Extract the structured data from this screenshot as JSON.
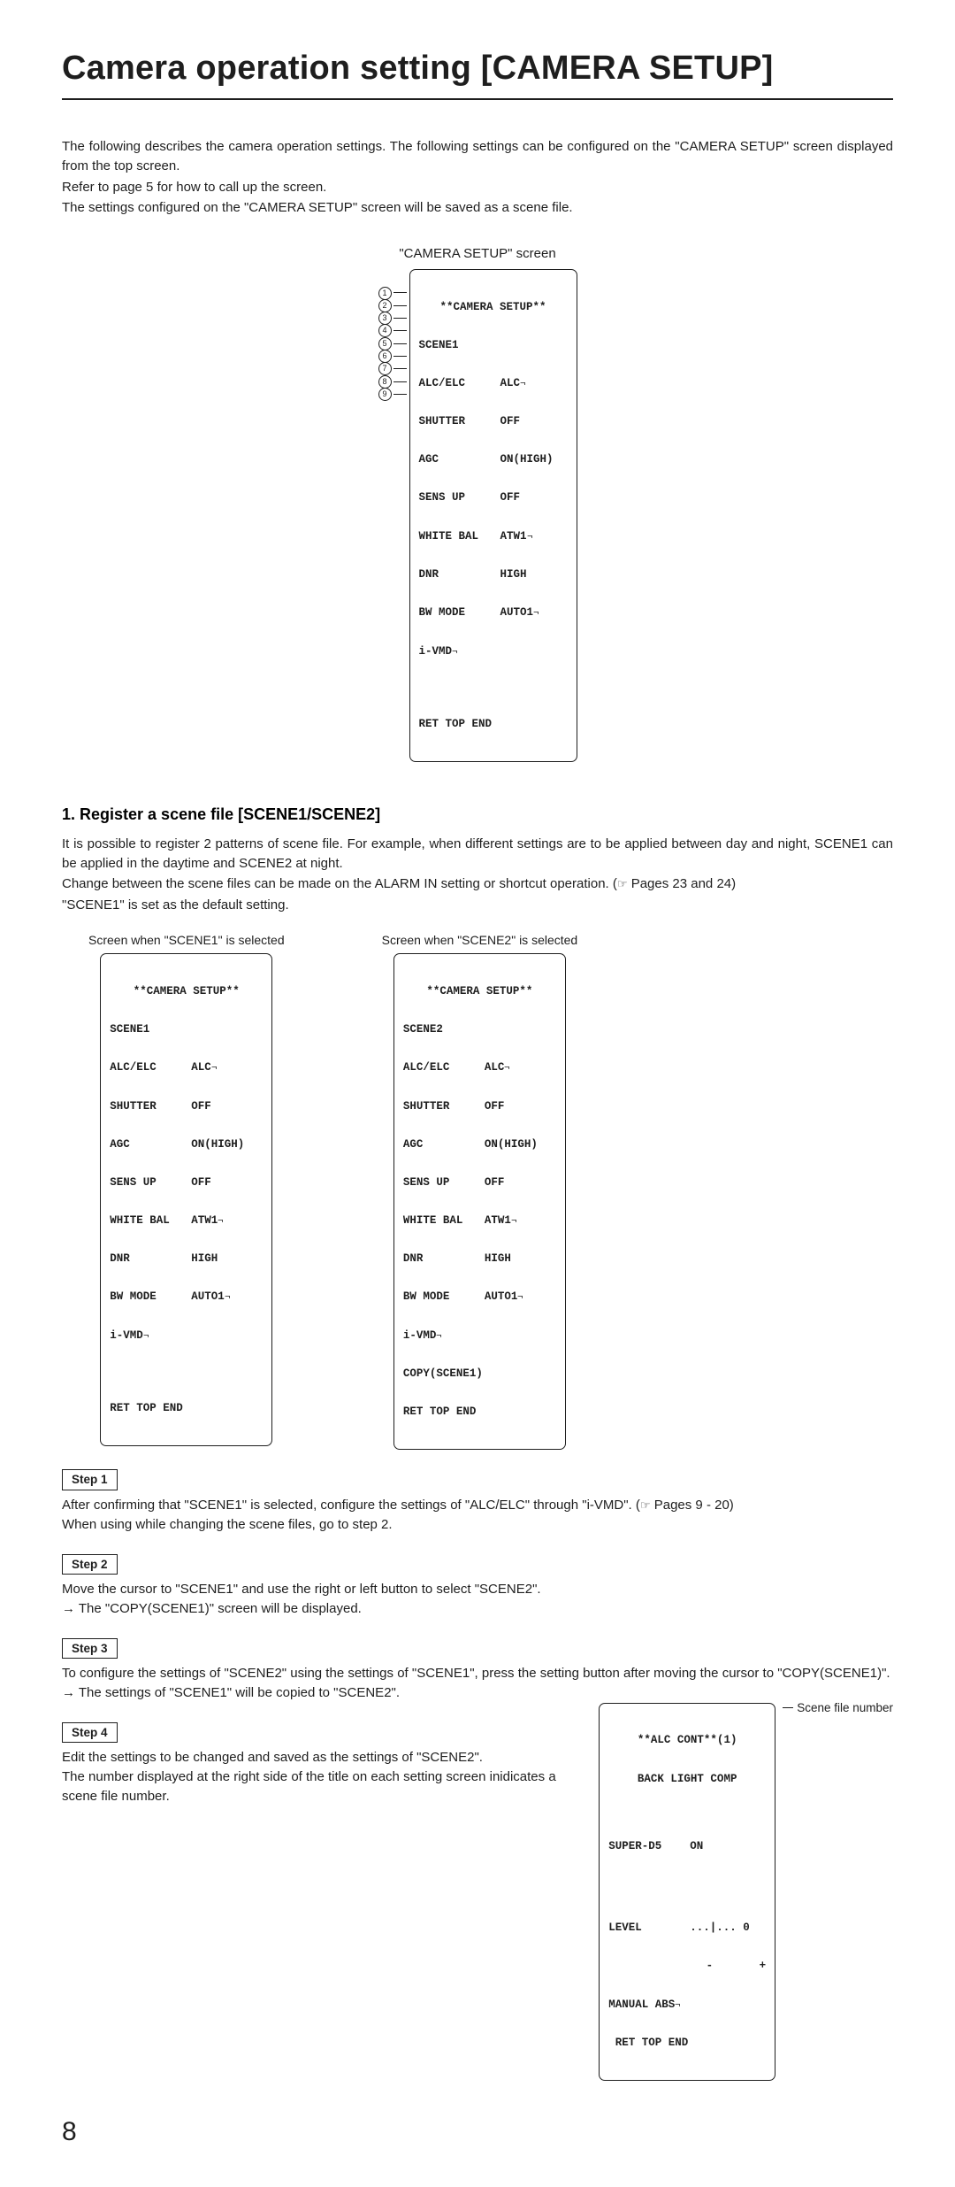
{
  "title": "Camera operation setting [CAMERA SETUP]",
  "intro1": "The following describes the camera operation settings. The following settings can be configured on the \"CAMERA SETUP\" screen displayed from the top screen.",
  "intro2": "Refer to page 5 for how to call up the screen.",
  "intro3": "The settings configured on the \"CAMERA SETUP\" screen will be saved as a scene file.",
  "main_screen_caption": "\"CAMERA SETUP\" screen",
  "osd_title": "**CAMERA SETUP**",
  "osd_items": [
    {
      "label": "SCENE1",
      "value": ""
    },
    {
      "label": "ALC/ELC",
      "value": "ALC",
      "sub": true
    },
    {
      "label": "SHUTTER",
      "value": "OFF"
    },
    {
      "label": "AGC",
      "value": "ON(HIGH)"
    },
    {
      "label": "SENS UP",
      "value": "OFF"
    },
    {
      "label": "WHITE BAL",
      "value": "ATW1",
      "sub": true
    },
    {
      "label": "DNR",
      "value": "HIGH"
    },
    {
      "label": "BW MODE",
      "value": "AUTO1",
      "sub": true
    },
    {
      "label": "i-VMD",
      "value": "",
      "sub": true
    }
  ],
  "osd_footer": "RET TOP END",
  "section1_heading": "1. Register a scene file [SCENE1/SCENE2]",
  "section1_p1": "It is possible to register 2 patterns of scene file. For example, when different settings are to be applied between day and night, SCENE1 can be applied in the daytime and SCENE2 at night.",
  "section1_p2a": "Change between the scene files can be made on the ALARM IN setting or shortcut operation. (",
  "section1_p2b": " Pages 23 and 24)",
  "section1_p3": "\"SCENE1\" is set as the default setting.",
  "pair_cap1": "Screen when \"SCENE1\" is selected",
  "pair_cap2": "Screen when \"SCENE2\" is selected",
  "scene2_extra": "COPY(SCENE1)",
  "scene2_first": "SCENE2",
  "step1_label": "Step 1",
  "step1_a": "After confirming that \"SCENE1\" is selected, configure the settings of \"ALC/ELC\" through \"i-VMD\". (",
  "step1_b": " Pages 9 - 20)",
  "step1_c": "When using while changing the scene files, go to step 2.",
  "step2_label": "Step 2",
  "step2_a": "Move the cursor to \"SCENE1\" and use the right or left button to select \"SCENE2\".",
  "step2_b": "→ The \"COPY(SCENE1)\" screen will be displayed.",
  "step3_label": "Step 3",
  "step3_a": "To configure the settings of \"SCENE2\" using the settings of \"SCENE1\", press the setting button after moving the cursor to \"COPY(SCENE1)\".",
  "step3_b": "→ The settings of \"SCENE1\" will be copied to \"SCENE2\".",
  "step4_label": "Step 4",
  "step4_a": "Edit the settings to be changed and saved as the settings of \"SCENE2\".",
  "step4_b": "The number displayed at the right side of the title on each setting screen inidicates a scene file number.",
  "alc_title": "**ALC CONT**(1)",
  "alc_r1": "BACK LIGHT COMP",
  "alc_r2a": "SUPER-D5",
  "alc_r2b": "ON",
  "alc_r3a": "LEVEL",
  "alc_r3b": "...|... 0",
  "alc_r4": "   -       +",
  "alc_r5": "MANUAL ABS",
  "scene_file_note": "Scene file number",
  "page_number": "8"
}
